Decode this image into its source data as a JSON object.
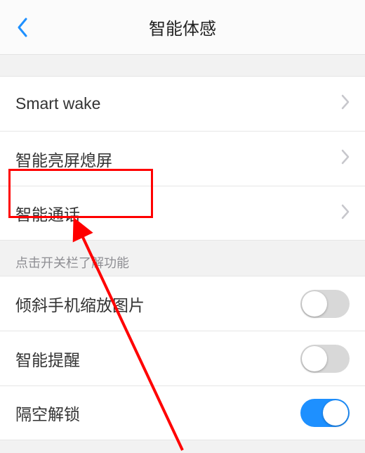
{
  "nav": {
    "title": "智能体感"
  },
  "rows_nav": [
    {
      "label": "Smart wake"
    },
    {
      "label": "智能亮屏熄屏"
    },
    {
      "label": "智能通话"
    }
  ],
  "section_hint": "点击开关栏了解功能",
  "rows_toggle": [
    {
      "label": "倾斜手机缩放图片",
      "on": false
    },
    {
      "label": "智能提醒",
      "on": false
    },
    {
      "label": "隔空解锁",
      "on": true
    }
  ],
  "annotation": {
    "highlight_target": "智能通话"
  }
}
